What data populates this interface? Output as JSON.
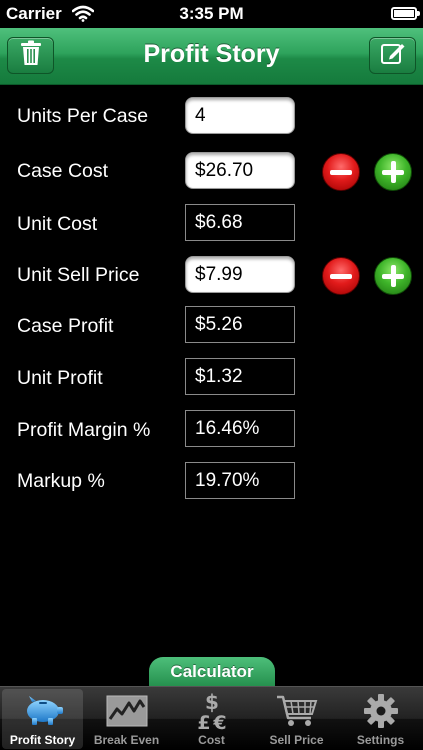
{
  "status_bar": {
    "carrier": "Carrier",
    "time": "3:35 PM"
  },
  "nav": {
    "title": "Profit Story",
    "left_icon": "trash-icon",
    "right_icon": "compose-icon"
  },
  "form": {
    "units_per_case": {
      "label": "Units Per Case",
      "value": "4"
    },
    "case_cost": {
      "label": "Case Cost",
      "value": "$26.70"
    },
    "unit_cost": {
      "label": "Unit Cost",
      "value": "$6.68"
    },
    "unit_sell_price": {
      "label": "Unit Sell Price",
      "value": "$7.99"
    },
    "case_profit": {
      "label": "Case Profit",
      "value": "$5.26"
    },
    "unit_profit": {
      "label": "Unit Profit",
      "value": "$1.32"
    },
    "profit_margin": {
      "label": "Profit Margin %",
      "value": "16.46%"
    },
    "markup": {
      "label": "Markup %",
      "value": "19.70%"
    }
  },
  "calculator_tab": {
    "label": "Calculator"
  },
  "tab_bar": {
    "tabs": [
      {
        "label": "Profit Story",
        "icon": "piggy-bank-icon",
        "active": true
      },
      {
        "label": "Break Even",
        "icon": "line-chart-icon",
        "active": false
      },
      {
        "label": "Cost",
        "icon": "currency-icon",
        "active": false
      },
      {
        "label": "Sell Price",
        "icon": "shopping-cart-icon",
        "active": false
      },
      {
        "label": "Settings",
        "icon": "gear-icon",
        "active": false
      }
    ]
  },
  "colors": {
    "nav_green": "#2ea35c",
    "minus_red": "#e21b1b",
    "plus_green": "#3fb52a",
    "background": "#000000"
  }
}
